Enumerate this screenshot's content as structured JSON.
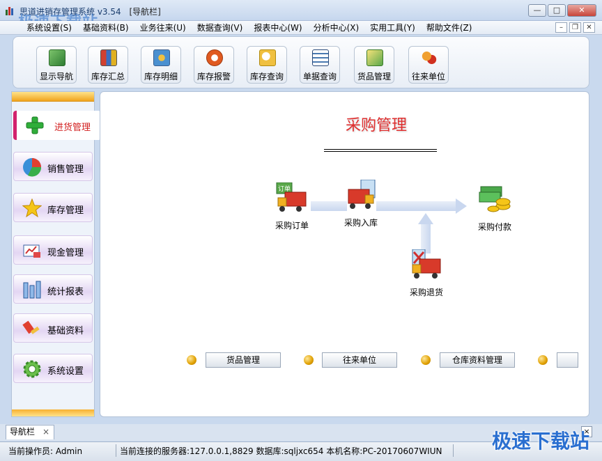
{
  "window": {
    "title": "[导航栏]",
    "title_prefix": "思道进销存管理系统 v3.54",
    "watermark": "极速下载站"
  },
  "menubar": {
    "items": [
      "系统设置(S)",
      "基础资料(B)",
      "业务往来(U)",
      "数据查询(V)",
      "报表中心(W)",
      "分析中心(X)",
      "实用工具(Y)",
      "帮助文件(Z)"
    ]
  },
  "toolbar": {
    "buttons": [
      {
        "label": "显示导航",
        "icon": "navigation-icon",
        "color": "#4a9a3a"
      },
      {
        "label": "库存汇总",
        "icon": "stock-summary-icon",
        "color": "#c0392b"
      },
      {
        "label": "库存明细",
        "icon": "stock-detail-icon",
        "color": "#2e86c1"
      },
      {
        "label": "库存报警",
        "icon": "stock-alarm-icon",
        "color": "#d35400"
      },
      {
        "label": "库存查询",
        "icon": "stock-query-icon",
        "color": "#e1a810"
      },
      {
        "label": "单据查询",
        "icon": "document-query-icon",
        "color": "#2874a6"
      },
      {
        "label": "货品管理",
        "icon": "goods-icon",
        "color": "#3c9a40"
      },
      {
        "label": "往来单位",
        "icon": "contacts-icon",
        "color": "#c0392b"
      }
    ]
  },
  "sidebar": {
    "items": [
      {
        "label": "进货管理",
        "icon": "plus-icon",
        "active": true
      },
      {
        "label": "销售管理",
        "icon": "pie-chart-icon",
        "active": false
      },
      {
        "label": "库存管理",
        "icon": "star-icon",
        "active": false
      },
      {
        "label": "现金管理",
        "icon": "cash-icon",
        "active": false
      },
      {
        "label": "统计报表",
        "icon": "bar-report-icon",
        "active": false
      },
      {
        "label": "基础资料",
        "icon": "brush-icon",
        "active": false
      },
      {
        "label": "系统设置",
        "icon": "gear-icon",
        "active": false
      }
    ]
  },
  "main": {
    "title": "采购管理",
    "flow": {
      "order": "采购订单",
      "inbound": "采购入库",
      "payment": "采购付款",
      "return": "采购退货",
      "order_tag": "订单"
    },
    "links": [
      "货品管理",
      "往来单位",
      "仓库资料管理",
      ""
    ]
  },
  "tabs": {
    "active": "导航栏",
    "close_glyph": "×"
  },
  "status": {
    "operator": "当前操作员: Admin",
    "connection": "当前连接的服务器:127.0.0.1,8829 数据库:sqljxc654 本机名称:PC-20170607WIUN"
  },
  "colors": {
    "accent_red": "#e03030",
    "sidebar_active_bar": "#d2226d",
    "orange": "#f0a41e"
  }
}
